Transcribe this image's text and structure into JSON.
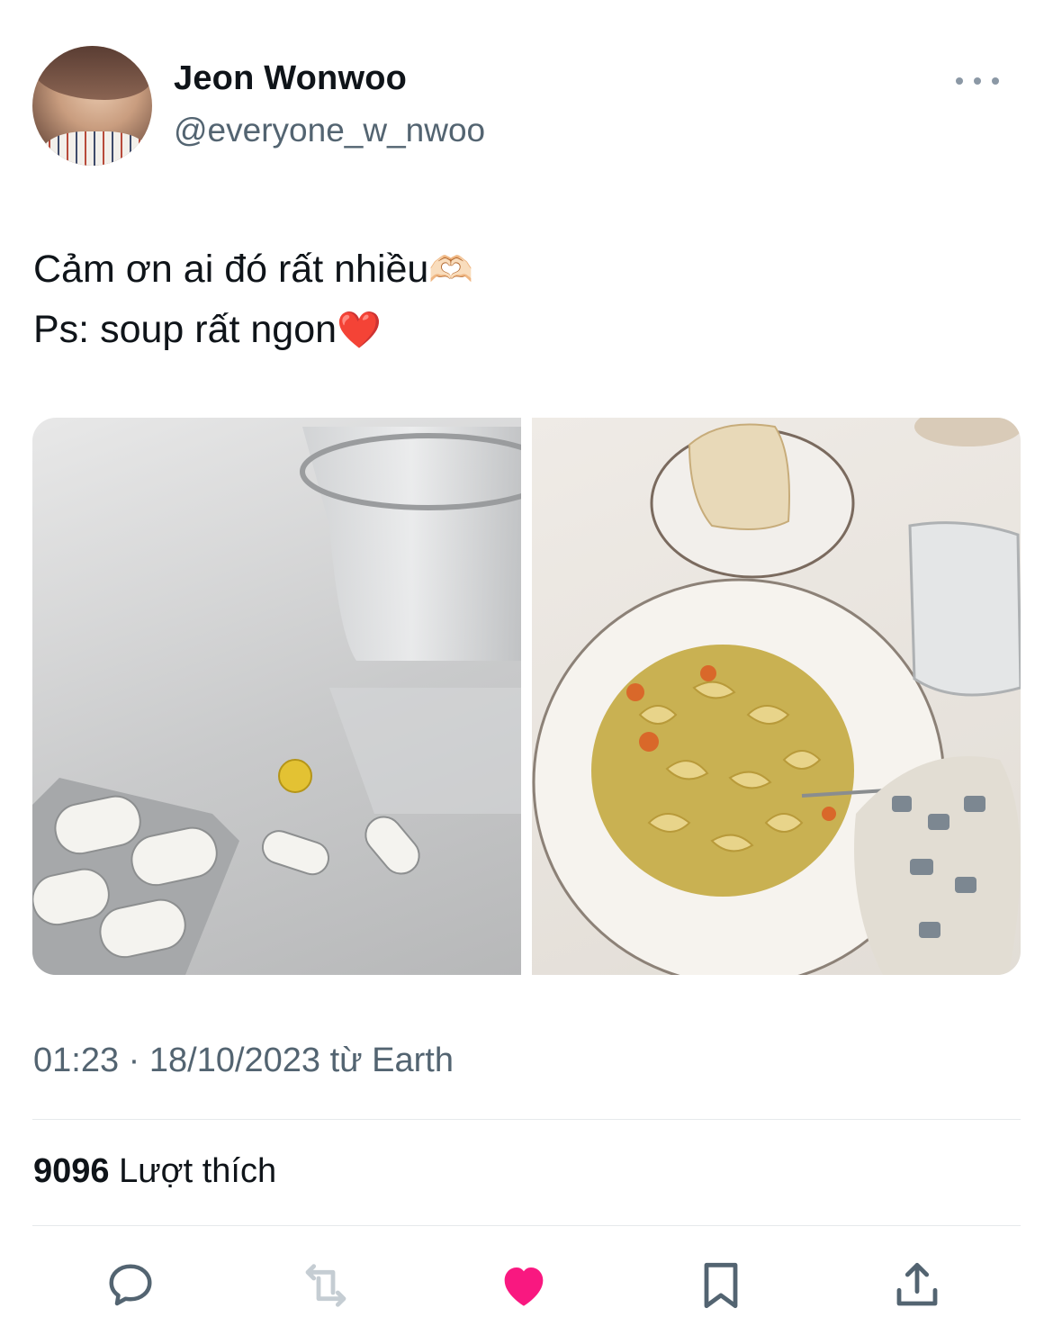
{
  "tweet": {
    "author": {
      "display_name": "Jeon Wonwoo",
      "handle": "@everyone_w_nwoo"
    },
    "text_line1": "Cảm ơn ai đó rất nhiều",
    "text_line1_emoji": "🫶🏻",
    "text_line2": "Ps: soup rất ngon",
    "text_line2_emoji": "❤️",
    "timestamp": "01:23 · 18/10/2023 từ Earth",
    "likes_count": "9096",
    "likes_label": "Lượt thích"
  },
  "actions": [
    {
      "name": "reply",
      "icon": "reply-icon"
    },
    {
      "name": "retweet",
      "icon": "retweet-icon"
    },
    {
      "name": "like",
      "icon": "heart-icon",
      "active": true
    },
    {
      "name": "bookmark",
      "icon": "bookmark-icon"
    },
    {
      "name": "share",
      "icon": "share-icon"
    }
  ],
  "colors": {
    "text_primary": "#0f1419",
    "text_secondary": "#536471",
    "like_active": "#f91880",
    "icon_default": "#536471"
  }
}
